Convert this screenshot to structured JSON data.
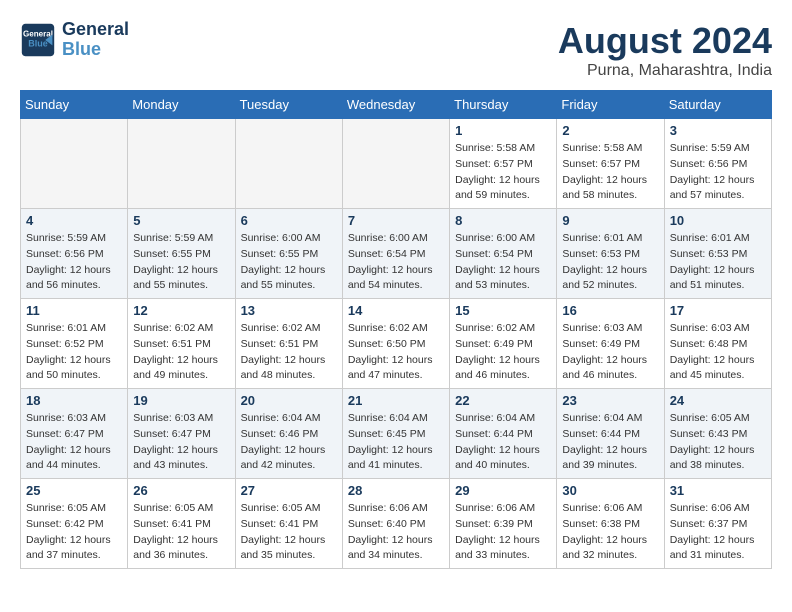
{
  "header": {
    "logo_line1": "General",
    "logo_line2": "Blue",
    "month_year": "August 2024",
    "location": "Purna, Maharashtra, India"
  },
  "days_of_week": [
    "Sunday",
    "Monday",
    "Tuesday",
    "Wednesday",
    "Thursday",
    "Friday",
    "Saturday"
  ],
  "weeks": [
    [
      {
        "num": "",
        "empty": true
      },
      {
        "num": "",
        "empty": true
      },
      {
        "num": "",
        "empty": true
      },
      {
        "num": "",
        "empty": true
      },
      {
        "num": "1",
        "sunrise": "5:58 AM",
        "sunset": "6:57 PM",
        "daylight": "12 hours and 59 minutes."
      },
      {
        "num": "2",
        "sunrise": "5:58 AM",
        "sunset": "6:57 PM",
        "daylight": "12 hours and 58 minutes."
      },
      {
        "num": "3",
        "sunrise": "5:59 AM",
        "sunset": "6:56 PM",
        "daylight": "12 hours and 57 minutes."
      }
    ],
    [
      {
        "num": "4",
        "sunrise": "5:59 AM",
        "sunset": "6:56 PM",
        "daylight": "12 hours and 56 minutes."
      },
      {
        "num": "5",
        "sunrise": "5:59 AM",
        "sunset": "6:55 PM",
        "daylight": "12 hours and 55 minutes."
      },
      {
        "num": "6",
        "sunrise": "6:00 AM",
        "sunset": "6:55 PM",
        "daylight": "12 hours and 55 minutes."
      },
      {
        "num": "7",
        "sunrise": "6:00 AM",
        "sunset": "6:54 PM",
        "daylight": "12 hours and 54 minutes."
      },
      {
        "num": "8",
        "sunrise": "6:00 AM",
        "sunset": "6:54 PM",
        "daylight": "12 hours and 53 minutes."
      },
      {
        "num": "9",
        "sunrise": "6:01 AM",
        "sunset": "6:53 PM",
        "daylight": "12 hours and 52 minutes."
      },
      {
        "num": "10",
        "sunrise": "6:01 AM",
        "sunset": "6:53 PM",
        "daylight": "12 hours and 51 minutes."
      }
    ],
    [
      {
        "num": "11",
        "sunrise": "6:01 AM",
        "sunset": "6:52 PM",
        "daylight": "12 hours and 50 minutes."
      },
      {
        "num": "12",
        "sunrise": "6:02 AM",
        "sunset": "6:51 PM",
        "daylight": "12 hours and 49 minutes."
      },
      {
        "num": "13",
        "sunrise": "6:02 AM",
        "sunset": "6:51 PM",
        "daylight": "12 hours and 48 minutes."
      },
      {
        "num": "14",
        "sunrise": "6:02 AM",
        "sunset": "6:50 PM",
        "daylight": "12 hours and 47 minutes."
      },
      {
        "num": "15",
        "sunrise": "6:02 AM",
        "sunset": "6:49 PM",
        "daylight": "12 hours and 46 minutes."
      },
      {
        "num": "16",
        "sunrise": "6:03 AM",
        "sunset": "6:49 PM",
        "daylight": "12 hours and 46 minutes."
      },
      {
        "num": "17",
        "sunrise": "6:03 AM",
        "sunset": "6:48 PM",
        "daylight": "12 hours and 45 minutes."
      }
    ],
    [
      {
        "num": "18",
        "sunrise": "6:03 AM",
        "sunset": "6:47 PM",
        "daylight": "12 hours and 44 minutes."
      },
      {
        "num": "19",
        "sunrise": "6:03 AM",
        "sunset": "6:47 PM",
        "daylight": "12 hours and 43 minutes."
      },
      {
        "num": "20",
        "sunrise": "6:04 AM",
        "sunset": "6:46 PM",
        "daylight": "12 hours and 42 minutes."
      },
      {
        "num": "21",
        "sunrise": "6:04 AM",
        "sunset": "6:45 PM",
        "daylight": "12 hours and 41 minutes."
      },
      {
        "num": "22",
        "sunrise": "6:04 AM",
        "sunset": "6:44 PM",
        "daylight": "12 hours and 40 minutes."
      },
      {
        "num": "23",
        "sunrise": "6:04 AM",
        "sunset": "6:44 PM",
        "daylight": "12 hours and 39 minutes."
      },
      {
        "num": "24",
        "sunrise": "6:05 AM",
        "sunset": "6:43 PM",
        "daylight": "12 hours and 38 minutes."
      }
    ],
    [
      {
        "num": "25",
        "sunrise": "6:05 AM",
        "sunset": "6:42 PM",
        "daylight": "12 hours and 37 minutes."
      },
      {
        "num": "26",
        "sunrise": "6:05 AM",
        "sunset": "6:41 PM",
        "daylight": "12 hours and 36 minutes."
      },
      {
        "num": "27",
        "sunrise": "6:05 AM",
        "sunset": "6:41 PM",
        "daylight": "12 hours and 35 minutes."
      },
      {
        "num": "28",
        "sunrise": "6:06 AM",
        "sunset": "6:40 PM",
        "daylight": "12 hours and 34 minutes."
      },
      {
        "num": "29",
        "sunrise": "6:06 AM",
        "sunset": "6:39 PM",
        "daylight": "12 hours and 33 minutes."
      },
      {
        "num": "30",
        "sunrise": "6:06 AM",
        "sunset": "6:38 PM",
        "daylight": "12 hours and 32 minutes."
      },
      {
        "num": "31",
        "sunrise": "6:06 AM",
        "sunset": "6:37 PM",
        "daylight": "12 hours and 31 minutes."
      }
    ]
  ],
  "labels": {
    "sunrise": "Sunrise:",
    "sunset": "Sunset:",
    "daylight": "Daylight:"
  }
}
